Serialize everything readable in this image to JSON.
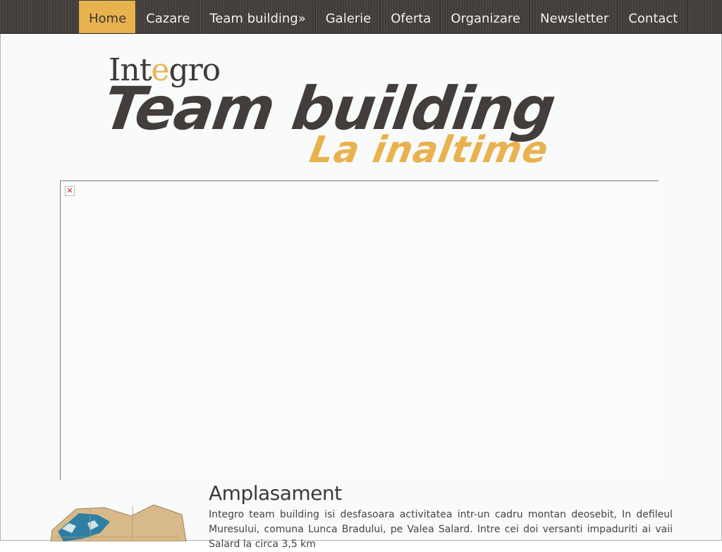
{
  "nav": {
    "items": [
      {
        "label": "Home"
      },
      {
        "label": "Cazare"
      },
      {
        "label": "Team building»"
      },
      {
        "label": "Galerie"
      },
      {
        "label": "Oferta"
      },
      {
        "label": "Organizare"
      },
      {
        "label": "Newsletter"
      },
      {
        "label": "Contact"
      }
    ],
    "active_index": 0
  },
  "logo": {
    "brand_part1": "Int",
    "brand_accent": "e",
    "brand_part2": "gro",
    "headline": "Team building",
    "subline": "La inaltime"
  },
  "slider": {
    "broken_image_glyph": "✕"
  },
  "section": {
    "title": "Amplasament",
    "text": "Integro team building isi desfasoara activitatea intr-un cadru montan deosebit, In defileul Muresului, comuna Lunca Bradului, pe Valea Salard. Intre cei doi versanti impaduriti ai vaii Salard la circa 3,5 km"
  },
  "colors": {
    "accent": "#e8b24f",
    "nav_bg": "#4a4542",
    "logo_dark": "#433e3b"
  }
}
